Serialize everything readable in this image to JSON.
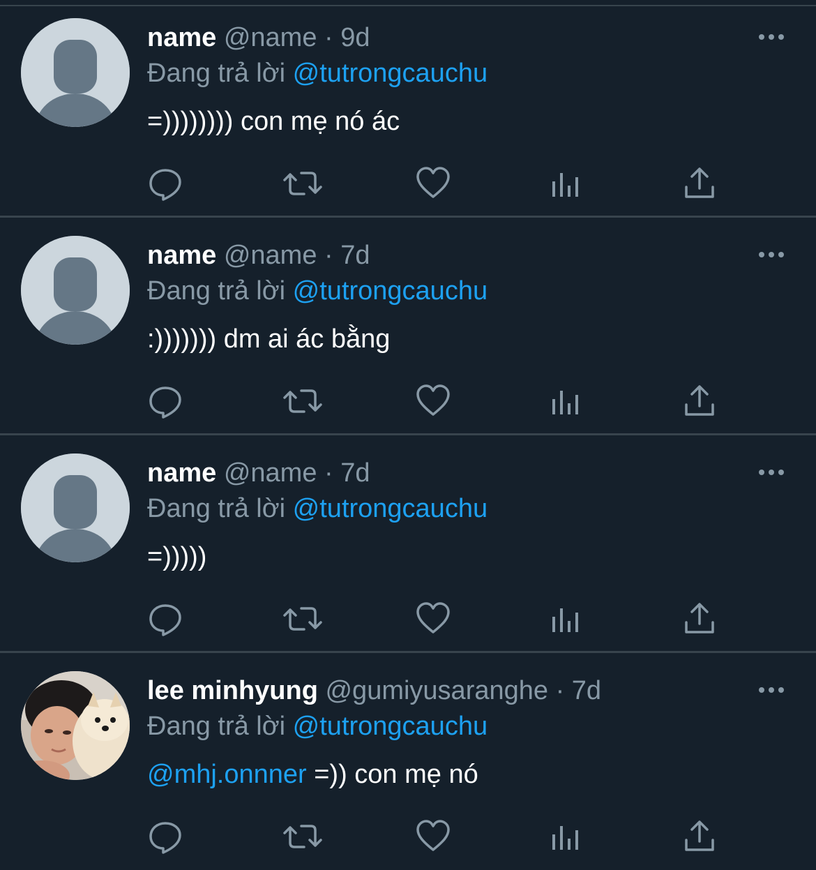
{
  "reply_prefix": "Đang trả lời",
  "icons": {
    "reply": "reply-icon",
    "retweet": "retweet-icon",
    "like": "heart-icon",
    "stats": "analytics-icon",
    "share": "share-icon",
    "more": "more-icon"
  },
  "colors": {
    "background": "#15202b",
    "divider": "#38444d",
    "secondary_text": "#8899a6",
    "accent": "#1da1f2",
    "primary_text": "#ffffff"
  },
  "tweets": [
    {
      "display_name": "name",
      "handle": "@name",
      "separator": "·",
      "time": "9d",
      "reply_to": "@tutrongcauchu",
      "mention": "",
      "text": "=)))))))) con mẹ nó ác",
      "avatar": "default-avatar"
    },
    {
      "display_name": "name",
      "handle": "@name",
      "separator": "·",
      "time": "7d",
      "reply_to": "@tutrongcauchu",
      "mention": "",
      "text": ":))))))) dm ai ác bằng",
      "avatar": "default-avatar"
    },
    {
      "display_name": "name",
      "handle": "@name",
      "separator": "·",
      "time": "7d",
      "reply_to": "@tutrongcauchu",
      "mention": "",
      "text": "=)))))",
      "avatar": "default-avatar"
    },
    {
      "display_name": "lee minhyung",
      "handle": "@gumiyusaranghe",
      "separator": "·",
      "time": "7d",
      "reply_to": "@tutrongcauchu",
      "mention": "@mhj.onnner",
      "text": " =)) con mẹ nó",
      "avatar": "photo-avatar"
    }
  ]
}
